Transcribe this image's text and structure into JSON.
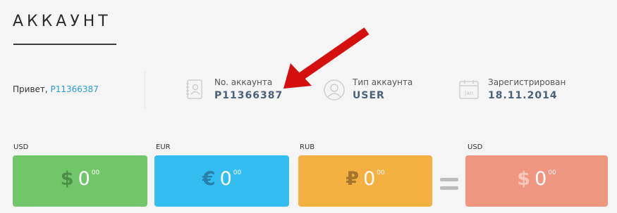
{
  "page": {
    "title": "АККАУНТ"
  },
  "greeting": {
    "prefix": "Привет, ",
    "account_link": "P11366387"
  },
  "info": [
    {
      "label": "No. аккаунта",
      "value": "P11366387",
      "icon": "address-book-icon"
    },
    {
      "label": "Тип аккаунта",
      "value": "USER",
      "icon": "user-icon"
    },
    {
      "label": "Зарегистрирован",
      "value": "18.11.2014",
      "icon": "calendar-icon",
      "icon_text": "Jan"
    }
  ],
  "balances": [
    {
      "currency": "USD",
      "symbol": "$",
      "amount": "0",
      "cents": "00",
      "color": "#72c66a",
      "symbol_color": "#4a8f45"
    },
    {
      "currency": "EUR",
      "symbol": "€",
      "amount": "0",
      "cents": "00",
      "color": "#33bdf0",
      "symbol_color": "#2a7fa6"
    },
    {
      "currency": "RUB",
      "symbol": "₽",
      "amount": "0",
      "cents": "00",
      "color": "#f4b041",
      "symbol_color": "#a5762a"
    }
  ],
  "total": {
    "currency": "USD",
    "symbol": "$",
    "amount": "0",
    "cents": "00",
    "color": "#ef9681",
    "symbol_color": "#f7c7bb"
  },
  "colors": {
    "link": "#2a9bd6",
    "value_text": "#4a6178",
    "arrow": "#d50e0e"
  }
}
